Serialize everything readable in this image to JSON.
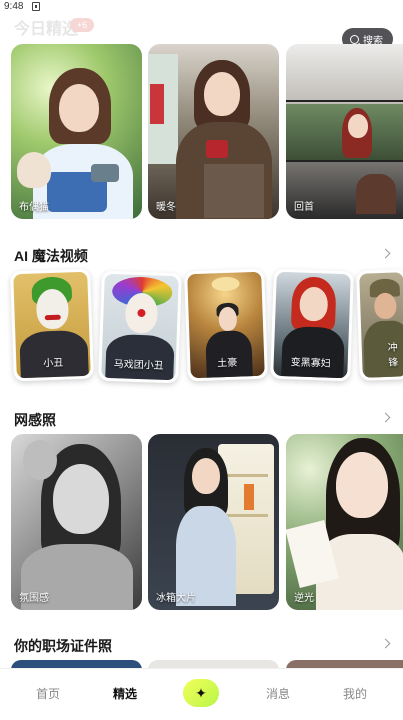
{
  "status_bar": {
    "time": "9:48"
  },
  "header": {
    "faded_title": "今日精选",
    "faded_badge": "+6"
  },
  "search": {
    "label": "搜索"
  },
  "today_picks": [
    {
      "label": "布偶猫"
    },
    {
      "label": "暖冬"
    },
    {
      "label": "回首"
    }
  ],
  "magic_video": {
    "title": "AI 魔法视频",
    "items": [
      {
        "label": "小丑"
      },
      {
        "label": "马戏团小丑"
      },
      {
        "label": "土豪"
      },
      {
        "label": "变黑寡妇"
      },
      {
        "label": "冲锋"
      }
    ]
  },
  "net_photos": {
    "title": "网感照",
    "items": [
      {
        "label": "氛围感"
      },
      {
        "label": "冰箱大片"
      },
      {
        "label": "逆光"
      }
    ]
  },
  "id_photos": {
    "title": "你的职场证件照"
  },
  "bottom_nav": {
    "home": "首页",
    "featured": "精选",
    "create": "+",
    "messages": "消息",
    "mine": "我的"
  }
}
